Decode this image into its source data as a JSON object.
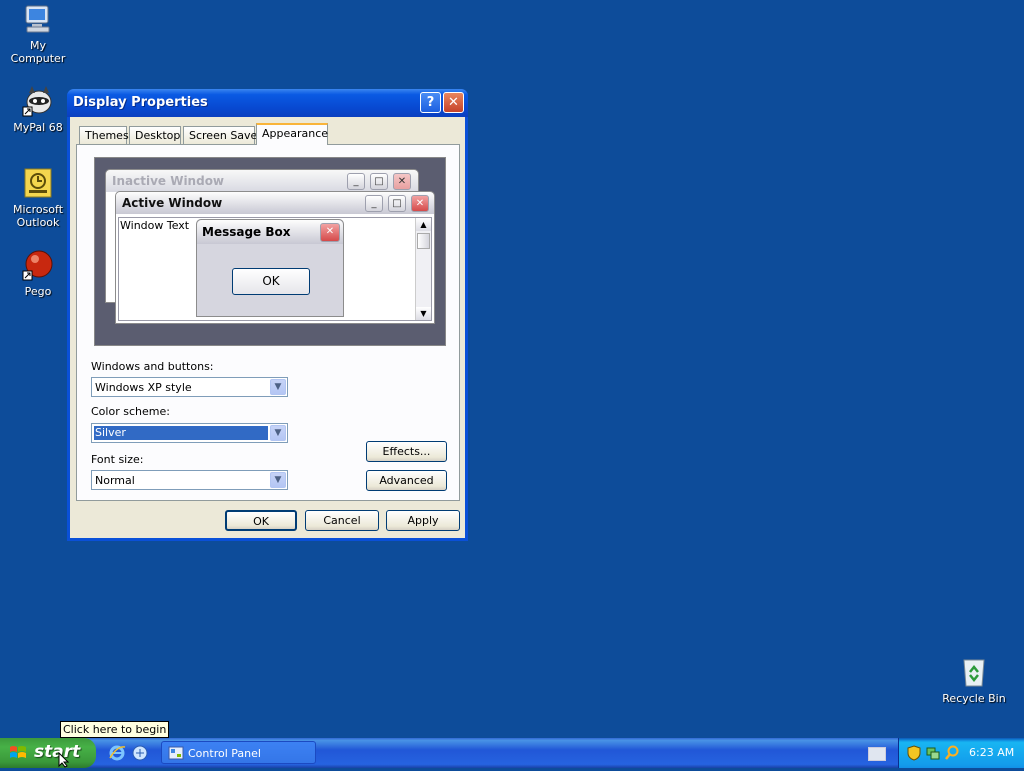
{
  "desktop": {
    "icons": [
      {
        "label": "My Computer"
      },
      {
        "label": "MyPal 68"
      },
      {
        "label": "Microsoft Outlook"
      },
      {
        "label": "Pego"
      },
      {
        "label": "Recycle Bin"
      }
    ]
  },
  "dialog": {
    "title": "Display Properties",
    "help_glyph": "?",
    "close_glyph": "✕",
    "tabs": [
      {
        "label": "Themes"
      },
      {
        "label": "Desktop"
      },
      {
        "label": "Screen Saver"
      },
      {
        "label": "Appearance",
        "active": true
      }
    ],
    "preview": {
      "inactive_title": "Inactive Window",
      "active_title": "Active Window",
      "window_text": "Window Text",
      "message_box_title": "Message Box",
      "ok_label": "OK"
    },
    "windows_and_buttons": {
      "label": "Windows and buttons:",
      "value": "Windows XP style"
    },
    "color_scheme": {
      "label": "Color scheme:",
      "value": "Silver"
    },
    "font_size": {
      "label": "Font size:",
      "value": "Normal"
    },
    "effects_label": "Effects...",
    "advanced_label": "Advanced",
    "ok_label": "OK",
    "cancel_label": "Cancel",
    "apply_label": "Apply"
  },
  "taskbar": {
    "start_label": "start",
    "tooltip": "Click here to begin",
    "task_label": "Control Panel",
    "clock": "6:23 AM"
  },
  "colors": {
    "desktop": "#0d4c9a",
    "titlebar": "#0a5ae3",
    "dialog_face": "#ece9d8",
    "selection": "#316ac5"
  }
}
